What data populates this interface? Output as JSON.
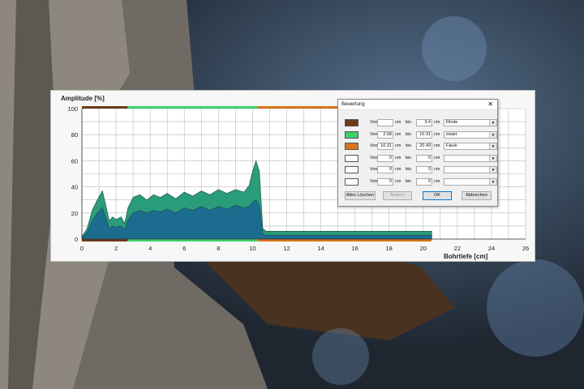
{
  "window": {
    "y_axis_title": "Amplitude [%]",
    "x_axis_title": "Bohrtiefe [cm]"
  },
  "colors": {
    "rinde": "#6b3b1a",
    "intakt": "#3ed06a",
    "faeule": "#d9731c",
    "fill_dark": "#1b6c8f",
    "fill_light": "#2a9c7a"
  },
  "chart_data": {
    "type": "area",
    "xlabel": "Bohrtiefe [cm]",
    "ylabel": "Amplitude [%]",
    "xlim": [
      0,
      26
    ],
    "ylim": [
      0,
      100
    ],
    "x_ticks": [
      "0",
      "2",
      "4",
      "6",
      "8",
      "10",
      "12",
      "14",
      "16",
      "18",
      "20",
      "22",
      "24",
      "26"
    ],
    "y_ticks": [
      "0",
      "20",
      "40",
      "60",
      "80",
      "100"
    ],
    "grid": true,
    "zones": [
      {
        "name": "Rinde",
        "from": 0,
        "to": 2.68,
        "color": "#6b3b1a"
      },
      {
        "name": "intakt",
        "from": 2.68,
        "to": 10.31,
        "color": "#3ed06a"
      },
      {
        "name": "Fäule",
        "from": 10.31,
        "to": 20.49,
        "color": "#d9731c"
      }
    ],
    "series": [
      {
        "name": "",
        "x": [
          0,
          0.3,
          0.6,
          0.9,
          1.2,
          1.4,
          1.6,
          1.8,
          2.0,
          2.3,
          2.5,
          2.7,
          3.0,
          3.4,
          3.8,
          4.2,
          4.6,
          5.0,
          5.5,
          6.0,
          6.5,
          7.0,
          7.5,
          8.0,
          8.5,
          9.0,
          9.5,
          9.8,
          10.0,
          10.2,
          10.4,
          10.6,
          10.8,
          11.0,
          12,
          14,
          16,
          18,
          20,
          20.5
        ],
        "y": [
          2,
          8,
          22,
          30,
          37,
          26,
          14,
          17,
          15,
          17,
          12,
          24,
          32,
          34,
          30,
          34,
          32,
          35,
          31,
          36,
          33,
          37,
          34,
          38,
          35,
          38,
          36,
          41,
          52,
          60,
          52,
          8,
          6,
          6,
          6,
          6,
          6,
          6,
          6,
          6
        ]
      },
      {
        "name": "",
        "x": [
          0,
          0.3,
          0.6,
          0.9,
          1.2,
          1.4,
          1.6,
          1.8,
          2.0,
          2.3,
          2.5,
          2.7,
          3.0,
          3.4,
          3.8,
          4.2,
          4.6,
          5.0,
          5.5,
          6.0,
          6.5,
          7.0,
          7.5,
          8.0,
          8.5,
          9.0,
          9.5,
          9.8,
          10.0,
          10.2,
          10.4,
          10.6,
          10.8,
          11.0,
          12,
          14,
          16,
          18,
          20,
          20.5
        ],
        "y": [
          1,
          5,
          14,
          20,
          24,
          16,
          8,
          10,
          9,
          10,
          7,
          15,
          20,
          22,
          20,
          22,
          21,
          23,
          20,
          24,
          22,
          25,
          22,
          25,
          23,
          26,
          24,
          25,
          28,
          30,
          26,
          4,
          3,
          3,
          3,
          3,
          3,
          3,
          3,
          3
        ]
      }
    ]
  },
  "dialog": {
    "title": "Bewertung",
    "close_label": "✕",
    "von_label": "Von",
    "bis_label": "bis",
    "cm_label": "cm",
    "rows": [
      {
        "color": "#6b3b1a",
        "from": "",
        "to": "3.4",
        "type": "Rinde"
      },
      {
        "color": "#3ed06a",
        "from": "2.68",
        "to": "10.31",
        "type": "intakt"
      },
      {
        "color": "#d9731c",
        "from": "10.31",
        "to": "20.49",
        "type": "Fäule"
      },
      {
        "color": "#ffffff",
        "from": "0",
        "to": "0",
        "type": ""
      },
      {
        "color": "#ffffff",
        "from": "0",
        "to": "0",
        "type": ""
      },
      {
        "color": "#ffffff",
        "from": "0",
        "to": "0",
        "type": ""
      }
    ],
    "buttons": {
      "clear_all": "Alles Löschen",
      "apply": "Ändern",
      "ok": "OK",
      "cancel": "Abbrechen"
    }
  }
}
